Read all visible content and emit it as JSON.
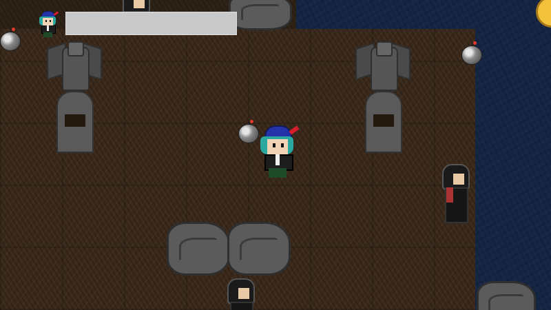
{
  "hud": {
    "player_avatar": "player-portrait",
    "health_fraction": 1.0,
    "bar_color": "#c9c9c9"
  },
  "colors": {
    "water": "#142543",
    "dirt": "#3b2a1c",
    "stone": "#5b5b5b",
    "coin": "#f2c23a",
    "player_hat": "#2533a8",
    "player_hair": "#2aa8a0",
    "feather": "#d81e2c"
  },
  "entities": {
    "player": "player-character",
    "enemies": [
      "hooded-enemy",
      "hooded-enemy",
      "hooded-enemy"
    ],
    "items": [
      "bomb",
      "bomb",
      "bomb",
      "gold-coin"
    ],
    "scenery": [
      "gargoyle-statue",
      "gargoyle-statue",
      "rock",
      "rock",
      "rock",
      "rock"
    ]
  }
}
